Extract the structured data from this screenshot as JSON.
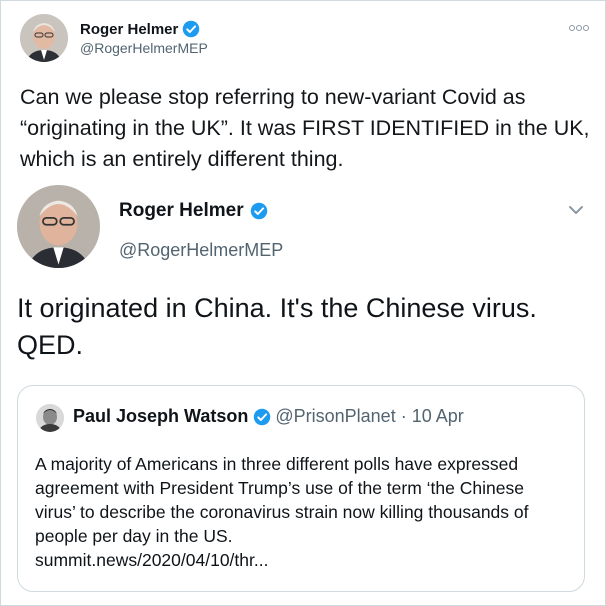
{
  "colors": {
    "verified": "#1d9bf0",
    "text": "#0f1419",
    "muted": "#536471",
    "border": "#cfd9de"
  },
  "tweet": {
    "author_name": "Roger Helmer",
    "author_handle": "@RogerHelmerMEP",
    "verified_icon": "verified-badge-icon",
    "more_icon": "more-options-icon",
    "text": "Can we please stop referring to new-variant Covid as “originating in the UK”. It was FIRST IDENTIFIED in the UK, which is an entirely different thing."
  },
  "embedded_tweet": {
    "author_name": "Roger Helmer",
    "author_handle": "@RogerHelmerMEP",
    "chevron_icon": "chevron-down-icon",
    "text": "It originated in China.  It's the Chinese virus. QED.",
    "quoted_tweet": {
      "author_name": "Paul Joseph Watson",
      "author_handle": "@PrisonPlanet",
      "separator": "·",
      "timestamp": "10 Apr",
      "text": "A majority of Americans in three different polls have expressed agreement with President Trump’s use of the term ‘the Chinese virus’ to describe the coronavirus strain now killing thousands of people per day in the US.",
      "link": "summit.news/2020/04/10/thr..."
    }
  }
}
